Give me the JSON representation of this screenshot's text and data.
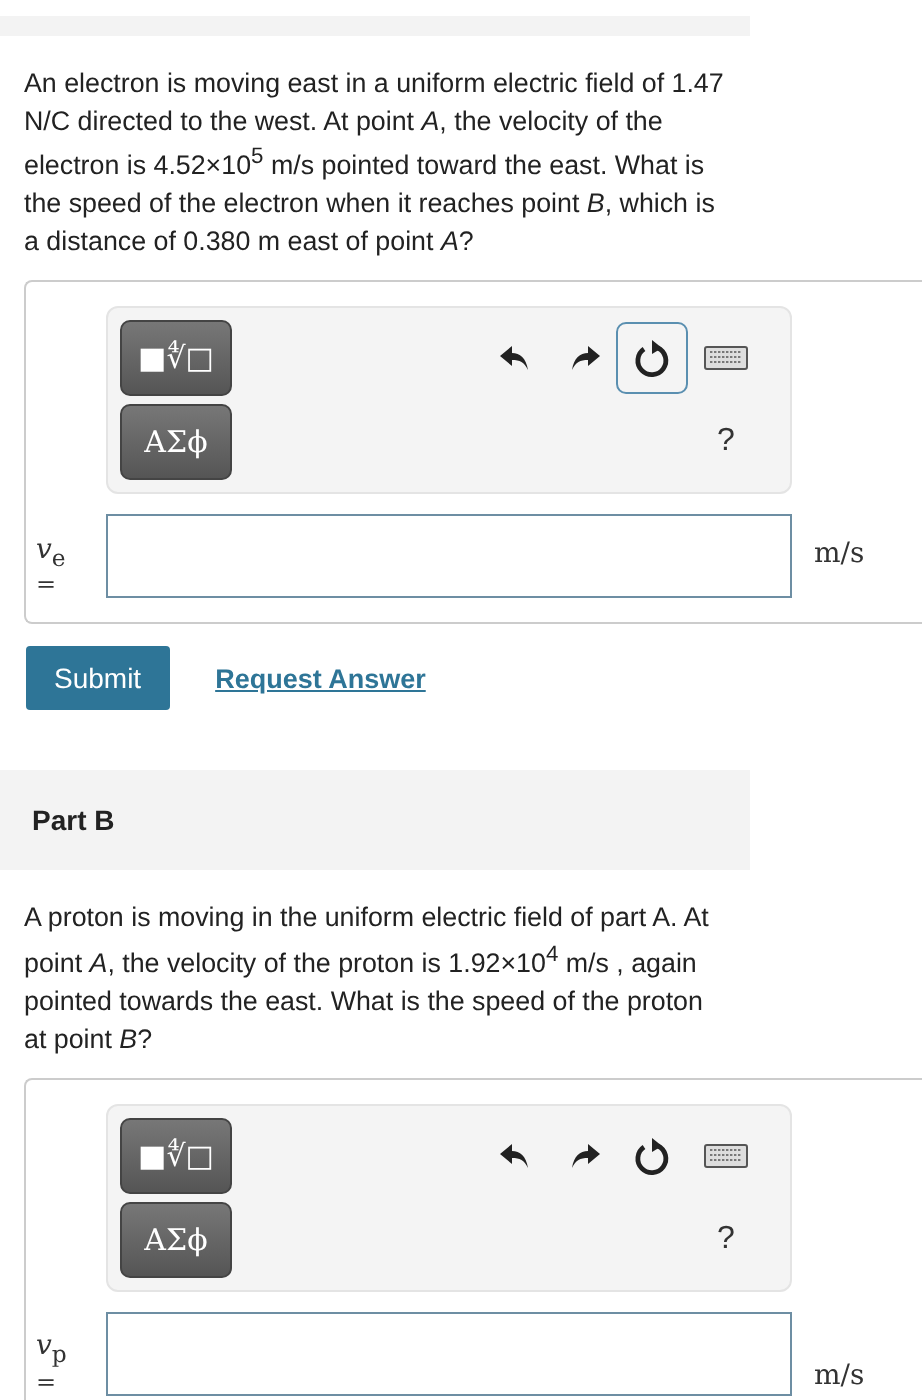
{
  "parts": [
    {
      "question": "An electron is moving east in a uniform electric field of 1.47 N/C directed to the west. At point *A*, the velocity of the electron is 4.52×10$^{5}$ m/s pointed toward the east. What is the speed of the electron when it reaches point *B*, which is a distance of 0.380 m east of point *A*?",
      "toolbar": {
        "templates_key": "■∜□",
        "greek_key": "ΑΣϕ",
        "reset_focused": true,
        "help": "?"
      },
      "answer": {
        "variable": "*v*$_{e}$",
        "equals": "=",
        "units": "m/s"
      },
      "actions": {
        "submit": "Submit",
        "request": "Request Answer"
      }
    },
    {
      "header": "Part B",
      "question": "A proton is moving in the uniform electric field of part A. At point *A*, the velocity of the proton is 1.92×10$^{4}$ m/s , again pointed towards the east. What is the speed of the proton at point *B*?",
      "toolbar": {
        "templates_key": "■∜□",
        "greek_key": "ΑΣϕ",
        "reset_focused": false,
        "help": "?"
      },
      "answer": {
        "variable": "*v*$_{p}$",
        "equals": "=",
        "units": "m/s"
      }
    }
  ]
}
